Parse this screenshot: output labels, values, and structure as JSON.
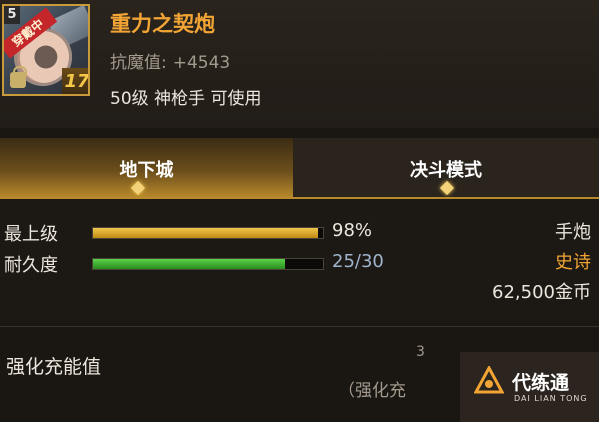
{
  "item": {
    "name": "重力之契炮",
    "level_badge": "5",
    "equipped_tag": "穿戴中",
    "enhance_level": "17",
    "stat_label": "抗魔值:",
    "stat_value": "+4543",
    "requirement": "50级 神枪手 可使用"
  },
  "tabs": [
    {
      "label": "地下城",
      "active": true
    },
    {
      "label": "决斗模式",
      "active": false
    }
  ],
  "rows": [
    {
      "label": "最上级",
      "value_text": "98%",
      "fill": 0.98,
      "color": "#f2c64a"
    },
    {
      "label": "耐久度",
      "value_text": "25/30",
      "fill": 0.833,
      "color": "#3cb22c"
    }
  ],
  "side": {
    "type": "手炮",
    "rarity": "史诗",
    "price": "62,500金币"
  },
  "enhance": {
    "label": "强化充能值",
    "value": "3",
    "detail": "（强化充"
  },
  "watermark": {
    "title": "代练通",
    "subtitle": "DAI LIAN TONG"
  },
  "colors": {
    "accent_gold": "#f2a535",
    "tab_gold": "#b98a2c"
  },
  "icons": [
    "lock-icon",
    "gem-icon",
    "watermark-logo-icon"
  ]
}
